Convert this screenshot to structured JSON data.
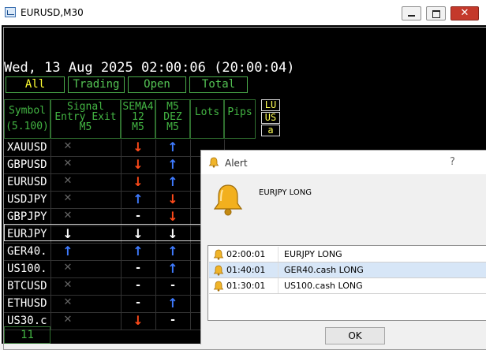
{
  "window": {
    "title": "EURUSD,M30"
  },
  "dashboard": {
    "datetime": "Wed, 13 Aug 2025 02:00:06 (20:00:04)",
    "tabs": [
      {
        "label": "All",
        "active": true
      },
      {
        "label": "Trading",
        "active": false
      },
      {
        "label": "Open",
        "active": false
      },
      {
        "label": "Total",
        "active": false
      }
    ],
    "headers": {
      "symbol": "Symbol",
      "symbol_sub": "(5.100)",
      "signal": "Signal",
      "signal_sub": "Entry Exit",
      "signal_tf": "M5",
      "sema_l1": "SEMA4",
      "sema_l2": "12",
      "sema_l3": "M5",
      "m5_l1": "M5",
      "m5_l2": "DEZ",
      "m5_l3": "M5",
      "lots": "Lots",
      "pips": "Pips"
    },
    "side_buttons": [
      "LU",
      "US",
      "a"
    ],
    "rows": [
      {
        "symbol": "XAUUSD",
        "entry": "x",
        "sema": "down",
        "dez": "up"
      },
      {
        "symbol": "GBPUSD",
        "entry": "x",
        "sema": "down",
        "dez": "up"
      },
      {
        "symbol": "EURUSD",
        "entry": "x",
        "sema": "down",
        "dez": "up"
      },
      {
        "symbol": "USDJPY",
        "entry": "x",
        "sema": "up",
        "dez": "down"
      },
      {
        "symbol": "GBPJPY",
        "entry": "x",
        "sema": "-",
        "dez": "down"
      },
      {
        "symbol": "EURJPY",
        "entry": "down-white",
        "sema": "down-white",
        "dez": "down-white"
      },
      {
        "symbol": "GER40.",
        "entry": "up",
        "sema": "up",
        "dez": "up"
      },
      {
        "symbol": "US100.",
        "entry": "x",
        "sema": "-",
        "dez": "up"
      },
      {
        "symbol": "BTCUSD",
        "entry": "x",
        "sema": "-",
        "dez": "-"
      },
      {
        "symbol": "ETHUSD",
        "entry": "x",
        "sema": "-",
        "dez": "up"
      },
      {
        "symbol": "US30.c",
        "entry": "x",
        "sema": "down",
        "dez": "-"
      }
    ],
    "footer_count": "11",
    "colors": {
      "up": "#3f7bff",
      "down": "#ff4a1a",
      "white": "#ffffff",
      "green": "#43b543",
      "yellow": "#ffff33"
    }
  },
  "alert": {
    "title": "Alert",
    "help": "?",
    "message": "EURJPY LONG",
    "entries": [
      {
        "time": "02:00:01",
        "text": "EURJPY LONG",
        "selected": false
      },
      {
        "time": "01:40:01",
        "text": "GER40.cash LONG",
        "selected": true
      },
      {
        "time": "01:30:01",
        "text": "US100.cash LONG",
        "selected": false
      }
    ],
    "ok_label": "OK"
  }
}
